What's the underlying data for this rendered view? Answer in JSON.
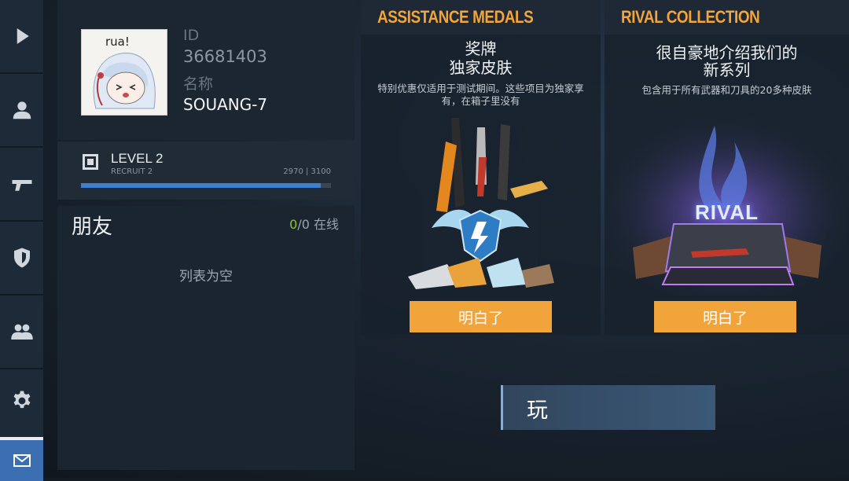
{
  "colors": {
    "accent_orange": "#f0a43a",
    "xp_bar": "#3d7fd0",
    "online_green": "#8fc13a",
    "rail_active": "#3b6fb1"
  },
  "sidebar": {
    "items": [
      {
        "icon": "play-icon"
      },
      {
        "icon": "profile-icon"
      },
      {
        "icon": "pistol-icon"
      },
      {
        "icon": "shield-icon"
      },
      {
        "icon": "team-icon"
      },
      {
        "icon": "gear-icon"
      },
      {
        "icon": "mail-icon"
      }
    ]
  },
  "profile": {
    "avatar_caption": "rua!",
    "id_label": "ID",
    "id_value": "36681403",
    "name_label": "名称",
    "name_value": "SOUANG-7"
  },
  "level": {
    "title": "LEVEL 2",
    "rank": "RECRUIT 2",
    "xp_text": "2970 | 3100",
    "progress": 0.958
  },
  "friends": {
    "title": "朋友",
    "online_count": "0",
    "total_text": "/0 在线",
    "empty_text": "列表为空"
  },
  "cards": [
    {
      "header": "ASSISTANCE MEDALS",
      "title_line1": "奖牌",
      "title_line2": "独家皮肤",
      "desc": "特别优惠仅适用于测试期间。这些项目为独家享有，在箱子里没有",
      "button": "明白了"
    },
    {
      "header": "RIVAL COLLECTION",
      "title_line1": "很自豪地介绍我们的",
      "title_line2": "新系列",
      "desc": "包含用于所有武器和刀具的20多种皮肤",
      "art_text": "RIVAL",
      "button": "明白了"
    }
  ],
  "play_button": "玩"
}
